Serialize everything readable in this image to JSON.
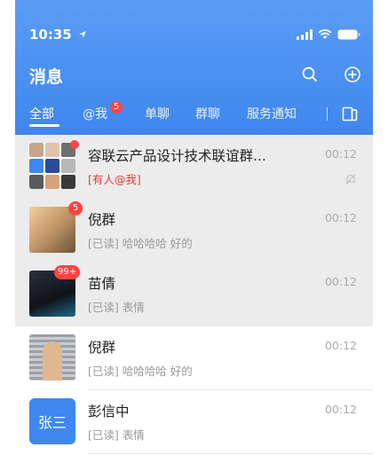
{
  "status_bar": {
    "time": "10:35"
  },
  "header": {
    "title": "消息"
  },
  "tabs": [
    {
      "label": "全部"
    },
    {
      "label": "@我",
      "badge": "5"
    },
    {
      "label": "单聊"
    },
    {
      "label": "群聊"
    },
    {
      "label": "服务通知"
    }
  ],
  "conversations": [
    {
      "name": "容联云产品设计技术联谊群...",
      "preview": "[有人@我]",
      "time": "00:12",
      "avatar_text": ""
    },
    {
      "name": "倪群",
      "preview": "[已读] 哈哈哈哈 好的",
      "time": "00:12",
      "badge": "5"
    },
    {
      "name": "苗倩",
      "preview": "[已读] 表情",
      "time": "00:12",
      "badge": "99+"
    },
    {
      "name": "倪群",
      "preview": "[已读] 哈哈哈哈 好的",
      "time": "00:12"
    },
    {
      "name": "彭信中",
      "preview": "[已读] 表情",
      "time": "00:12",
      "avatar_text": "张三"
    }
  ],
  "colors": {
    "header_top": "#5a9df5",
    "header_bottom": "#3f86ef",
    "badge": "#ff4444",
    "alert": "#e0403a",
    "pinned_bg": "#ececec"
  },
  "icons": [
    "location-arrow-icon",
    "signal-icon",
    "wifi-icon",
    "battery-icon",
    "search-icon",
    "add-circle-icon",
    "contacts-book-icon",
    "mute-bell-icon"
  ]
}
